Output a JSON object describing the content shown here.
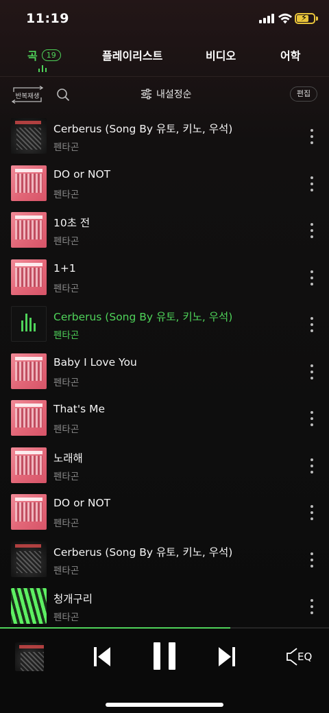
{
  "status_bar": {
    "time": "11:19"
  },
  "tabs": [
    {
      "label": "곡",
      "count": "19",
      "active": true
    },
    {
      "label": "플레이리스트"
    },
    {
      "label": "비디오"
    },
    {
      "label": "어학"
    }
  ],
  "toolbar": {
    "repeat_label": "반복재생",
    "sort_label": "내설정순",
    "edit_label": "편집"
  },
  "songs": [
    {
      "title": "Cerberus (Song By 유토, 키노, 우석)",
      "artist": "펜타곤",
      "art": "dark"
    },
    {
      "title": "DO or NOT",
      "artist": "펜타곤",
      "art": "pink"
    },
    {
      "title": "10초 전",
      "artist": "펜타곤",
      "art": "pink"
    },
    {
      "title": "1+1",
      "artist": "펜타곤",
      "art": "pink"
    },
    {
      "title": "Cerberus (Song By 유토, 키노, 우석)",
      "artist": "펜타곤",
      "art": "playing",
      "playing": true
    },
    {
      "title": "Baby I Love You",
      "artist": "펜타곤",
      "art": "pink"
    },
    {
      "title": "That's Me",
      "artist": "펜타곤",
      "art": "pink"
    },
    {
      "title": "노래해",
      "artist": "펜타곤",
      "art": "pink"
    },
    {
      "title": "DO or NOT",
      "artist": "펜타곤",
      "art": "pink"
    },
    {
      "title": "Cerberus (Song By 유토, 키노, 우석)",
      "artist": "펜타곤",
      "art": "dark"
    },
    {
      "title": "청개구리",
      "artist": "펜타곤",
      "art": "green"
    }
  ],
  "player": {
    "progress": 0.7,
    "eq_label": "EQ"
  },
  "colors": {
    "accent": "#4fd45a",
    "background": "#0e0e0e",
    "secondary_text": "#8a8a8a"
  }
}
